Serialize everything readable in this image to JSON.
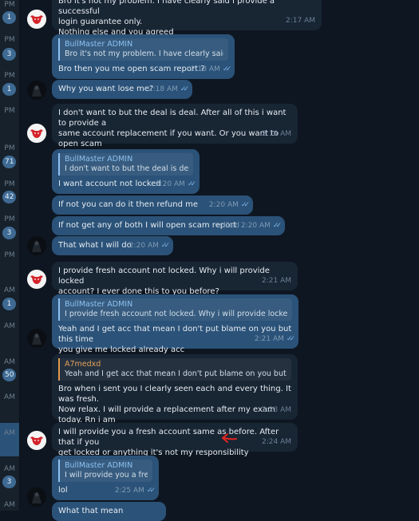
{
  "sidebar": [
    {
      "time": "PM",
      "badge": "1"
    },
    {
      "time": "PM",
      "badge": "3"
    },
    {
      "time": "PM",
      "badge": "1"
    },
    {
      "time": "PM",
      "badge": ""
    },
    {
      "time": "PM",
      "badge": "71"
    },
    {
      "time": "PM",
      "badge": "42"
    },
    {
      "time": "PM",
      "badge": "3"
    },
    {
      "time": "PM",
      "badge": ""
    },
    {
      "time": "AM",
      "badge": "1"
    },
    {
      "time": "AM",
      "badge": ""
    },
    {
      "time": "AM",
      "badge": "50"
    },
    {
      "time": "AM",
      "badge": ""
    },
    {
      "time": "AM",
      "badge": ""
    },
    {
      "time": "AM",
      "badge": "3"
    },
    {
      "time": "AM",
      "badge": ""
    }
  ],
  "messages": {
    "m0": {
      "text": "Bro it's not my problem. I have clearly said I provide a successful\nlogin guarantee only.\nNothing else and you agreed",
      "time": "2:17 AM"
    },
    "m1": {
      "reply_name": "BullMaster ADMIN",
      "reply_text": "Bro it's not my problem. I have clearly said I pr...",
      "text": "Bro then you me open scam report ?",
      "time": "2:18 AM"
    },
    "m2": {
      "text": "Why you want lose me?",
      "time": "2:18 AM"
    },
    "m3": {
      "text": "I don't want to but the deal is deal. After all of this i want to provide a\nsame account replacement if you want. Or you want to open scam\nreport you can do np",
      "time": "2:19 AM"
    },
    "m4": {
      "reply_name": "BullMaster ADMIN",
      "reply_text": "I don't want to but the deal is deal. ...",
      "text": "I want account not locked",
      "time": "2:20 AM"
    },
    "m5": {
      "text": "If not you can do it then refund me",
      "time": "2:20 AM"
    },
    "m6": {
      "text": "If not get any of both I will open scam report",
      "edited": "edited",
      "time": "2:20 AM"
    },
    "m7": {
      "text": "That what I will do",
      "time": "2:20 AM"
    },
    "m8": {
      "text": "I provide fresh account not locked. Why i will provide locked\naccount? I ever done this to you before?",
      "time": "2:21 AM"
    },
    "m9": {
      "reply_name": "BullMaster ADMIN",
      "reply_text": "I provide fresh account not locked. Why i will provide locked acc...",
      "text": "Yeah and I get acc that mean I don't put blame on you but this time\nyou give me locked already acc",
      "time": "2:21 AM"
    },
    "m10": {
      "reply_name": "A7medxd",
      "reply_text": "Yeah and I get acc that mean I don't put blame on you but this ti...",
      "text": "Bro when i sent you I clearly seen each and every thing. It was fresh.\nNow relax. I will provide a replacement after my exam today. Rn i am\nstudying for exam",
      "time": "2:23 AM"
    },
    "m11": {
      "text": "I will provide you a fresh account same as before. After that if you\nget locked or anything it's not my responsibility",
      "time": "2:24 AM"
    },
    "m12": {
      "reply_name": "BullMaster ADMIN",
      "reply_text": "I will provide you a fres...",
      "text": "lol",
      "time": "2:25 AM"
    },
    "m13": {
      "text": "What that mean"
    }
  },
  "colors": {
    "bg": "#0e1621",
    "incoming": "#182533",
    "outgoing": "#2b5278",
    "accent": "#8ec1f0",
    "annotation": "#e0261f"
  },
  "icons": {
    "ticks": "double-check-icon",
    "arrow": "red-arrow-annotation"
  }
}
